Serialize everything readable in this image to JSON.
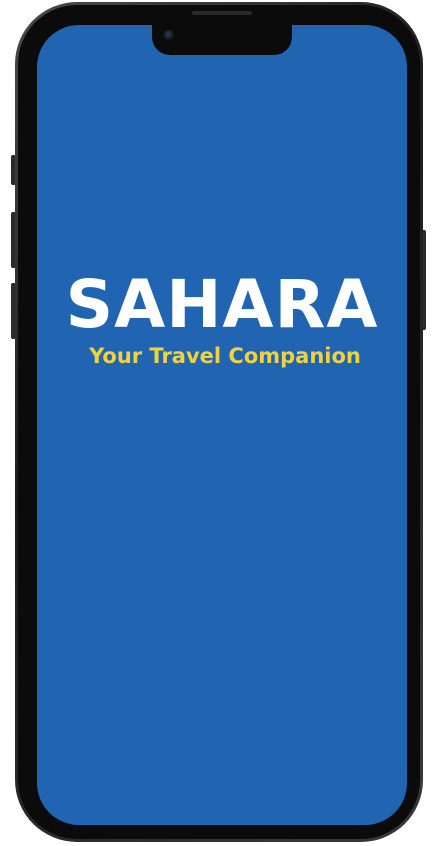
{
  "app": {
    "title": "SAHARA",
    "tagline": "Your Travel Companion"
  },
  "colors": {
    "screen_background": "#2165b2",
    "title": "#ffffff",
    "tagline": "#f0d23c",
    "device_frame": "#1c1c1c"
  },
  "icons": {
    "front_camera": "camera-icon"
  }
}
